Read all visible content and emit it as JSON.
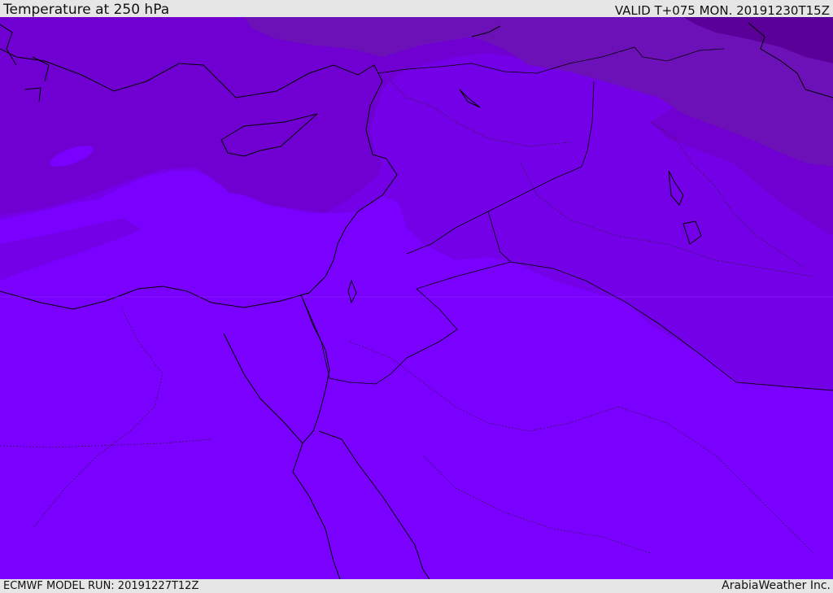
{
  "header": {
    "title": "Temperature at 250 hPa",
    "valid_time": "VALID T+075 MON. 20191230T15Z"
  },
  "footer": {
    "model_run": "ECMWF MODEL RUN: 20191227T12Z",
    "credit": "ArabiaWeather Inc."
  },
  "colors": {
    "background_bar": "#e6e6e6",
    "temp_warmest": "#7a00ff",
    "temp_band_2": "#7400e8",
    "temp_band_3": "#7000d2",
    "temp_band_4": "#6c10b8",
    "temp_coldest": "#5a0098",
    "coastline": "#000000"
  }
}
